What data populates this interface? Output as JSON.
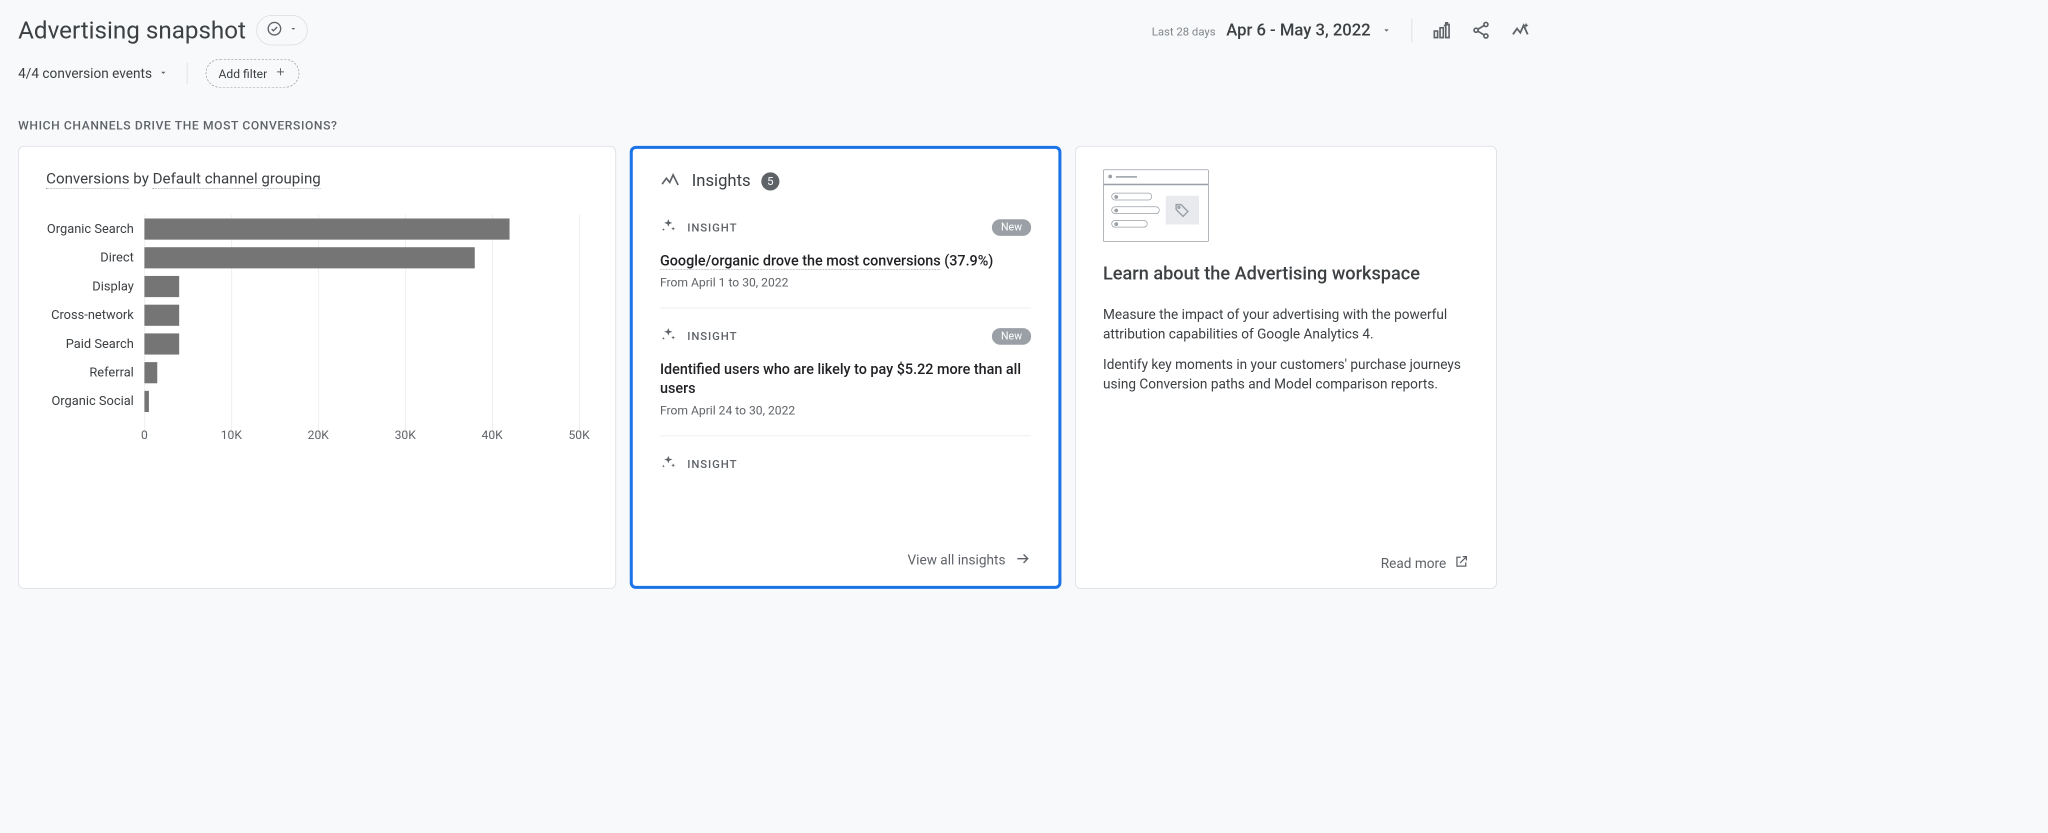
{
  "header": {
    "title": "Advertising snapshot",
    "date_prefix": "Last 28 days",
    "date_range": "Apr 6 - May 3, 2022"
  },
  "toolbar": {
    "conversion_label": "4/4 conversion events",
    "add_filter_label": "Add filter"
  },
  "section": {
    "heading": "WHICH CHANNELS DRIVE THE MOST CONVERSIONS?"
  },
  "chart_card": {
    "metric_label": "Conversions",
    "by_label": " by ",
    "dim_label": "Default channel grouping"
  },
  "chart_data": {
    "type": "bar",
    "orientation": "horizontal",
    "categories": [
      "Organic Search",
      "Direct",
      "Display",
      "Cross-network",
      "Paid Search",
      "Referral",
      "Organic Social"
    ],
    "values": [
      42000,
      38000,
      4000,
      4000,
      4000,
      1500,
      500
    ],
    "xticks": [
      0,
      10000,
      20000,
      30000,
      40000,
      50000
    ],
    "xtick_labels": [
      "0",
      "10K",
      "20K",
      "30K",
      "40K",
      "50K"
    ],
    "xlim": [
      0,
      50000
    ],
    "title": "Conversions by Default channel grouping"
  },
  "insights": {
    "title": "Insights",
    "count": "5",
    "view_all_label": "View all insights",
    "tag_label": "INSIGHT",
    "new_label": "New",
    "items": [
      {
        "title_key": "Google/organic drove the most conversions",
        "title_suffix": " (37.9%)",
        "sub": "From April 1 to 30, 2022",
        "is_new": true
      },
      {
        "title_full": "Identified users who are likely to pay $5.22 more than all users",
        "sub": "From April 24 to 30, 2022",
        "is_new": true
      },
      {
        "title_full": "",
        "sub": "",
        "is_new": false
      }
    ]
  },
  "learn": {
    "title": "Learn about the Advertising workspace",
    "p1": "Measure the impact of your advertising with the powerful attribution capabilities of Google Analytics 4.",
    "p2": "Identify key moments in your customers' purchase journeys using Conversion paths and Model comparison reports.",
    "read_more_label": "Read more"
  }
}
